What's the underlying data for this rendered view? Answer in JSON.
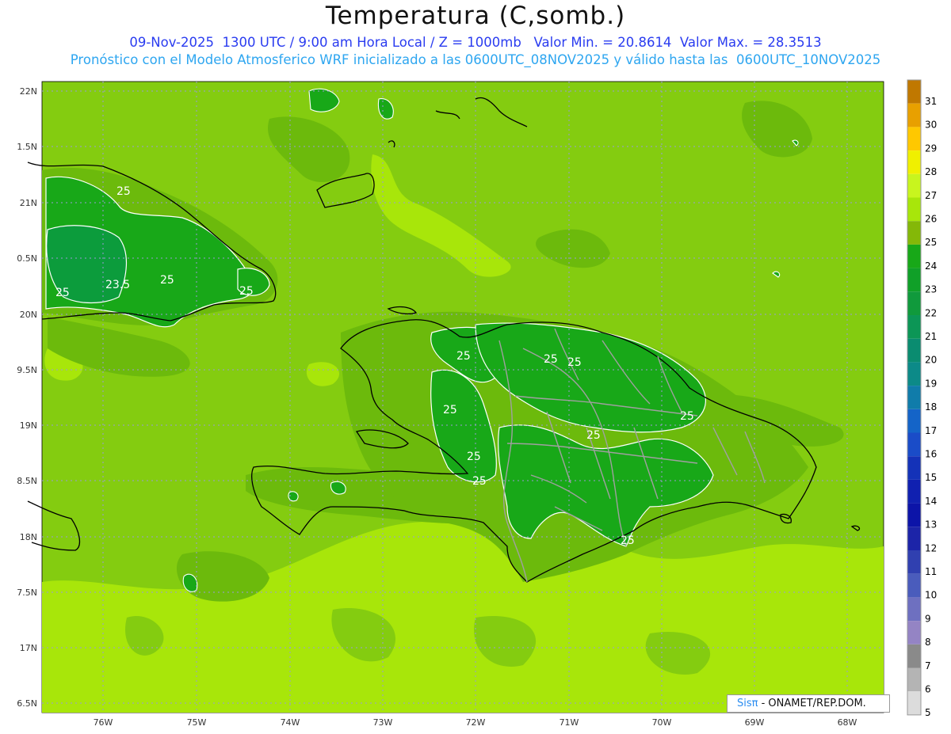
{
  "header": {
    "title": "Temperatura (C,somb.)",
    "line1": "09-Nov-2025  1300 UTC / 9:00 am Hora Local / Z = 1000mb   Valor Min. = 20.8614  Valor Max. = 28.3513",
    "line2": "Pronóstico con el Modelo Atmosferico WRF inicializado a las 0600UTC_08NOV2025 y válido hasta las  0600UTC_10NOV2025"
  },
  "map": {
    "lat_labels": [
      "22N",
      "1.5N",
      "21N",
      "0.5N",
      "20N",
      "9.5N",
      "19N",
      "8.5N",
      "18N",
      "7.5N",
      "17N",
      "6.5N"
    ],
    "lon_labels": [
      "76W",
      "75W",
      "74W",
      "73W",
      "72W",
      "71W",
      "70W",
      "69W",
      "68W"
    ],
    "contour_labels": [
      "25",
      "25",
      "23.5",
      "25",
      "25",
      "25",
      "25",
      "25",
      "25",
      "25",
      "25",
      "25",
      "25",
      "25"
    ],
    "colors": {
      "t24": "#18a818",
      "t25": "#5eb80a",
      "t26": "#84cc10",
      "t27": "#a8e60a",
      "t23": "#0c9c3c",
      "coast": "#000000",
      "border": "#a0a0a0",
      "grid": "#9a9ad8"
    }
  },
  "colorbar": {
    "values": [
      "31",
      "30",
      "29",
      "28",
      "27",
      "26",
      "25",
      "24",
      "23",
      "22",
      "21",
      "20",
      "19",
      "18",
      "17",
      "16",
      "15",
      "14",
      "13",
      "12",
      "11",
      "10",
      "9",
      "8",
      "7",
      "6",
      "5"
    ],
    "colors": [
      "#c07800",
      "#e8a000",
      "#ffc800",
      "#f0f000",
      "#c8f51e",
      "#a8e60a",
      "#84b808",
      "#18a818",
      "#10a028",
      "#109a3c",
      "#0c9656",
      "#0a8c70",
      "#0c8a88",
      "#107caa",
      "#1464c8",
      "#1a4cc8",
      "#1432b8",
      "#1020b0",
      "#0c14a8",
      "#1c24a8",
      "#3040b0",
      "#4a5cbc",
      "#6e70c0",
      "#9484c4",
      "#8a8a8a",
      "#b4b4b4",
      "#dcdcdc"
    ]
  },
  "credit": {
    "brand": "Sisπ",
    "text": "- ONAMET/REP.DOM."
  }
}
